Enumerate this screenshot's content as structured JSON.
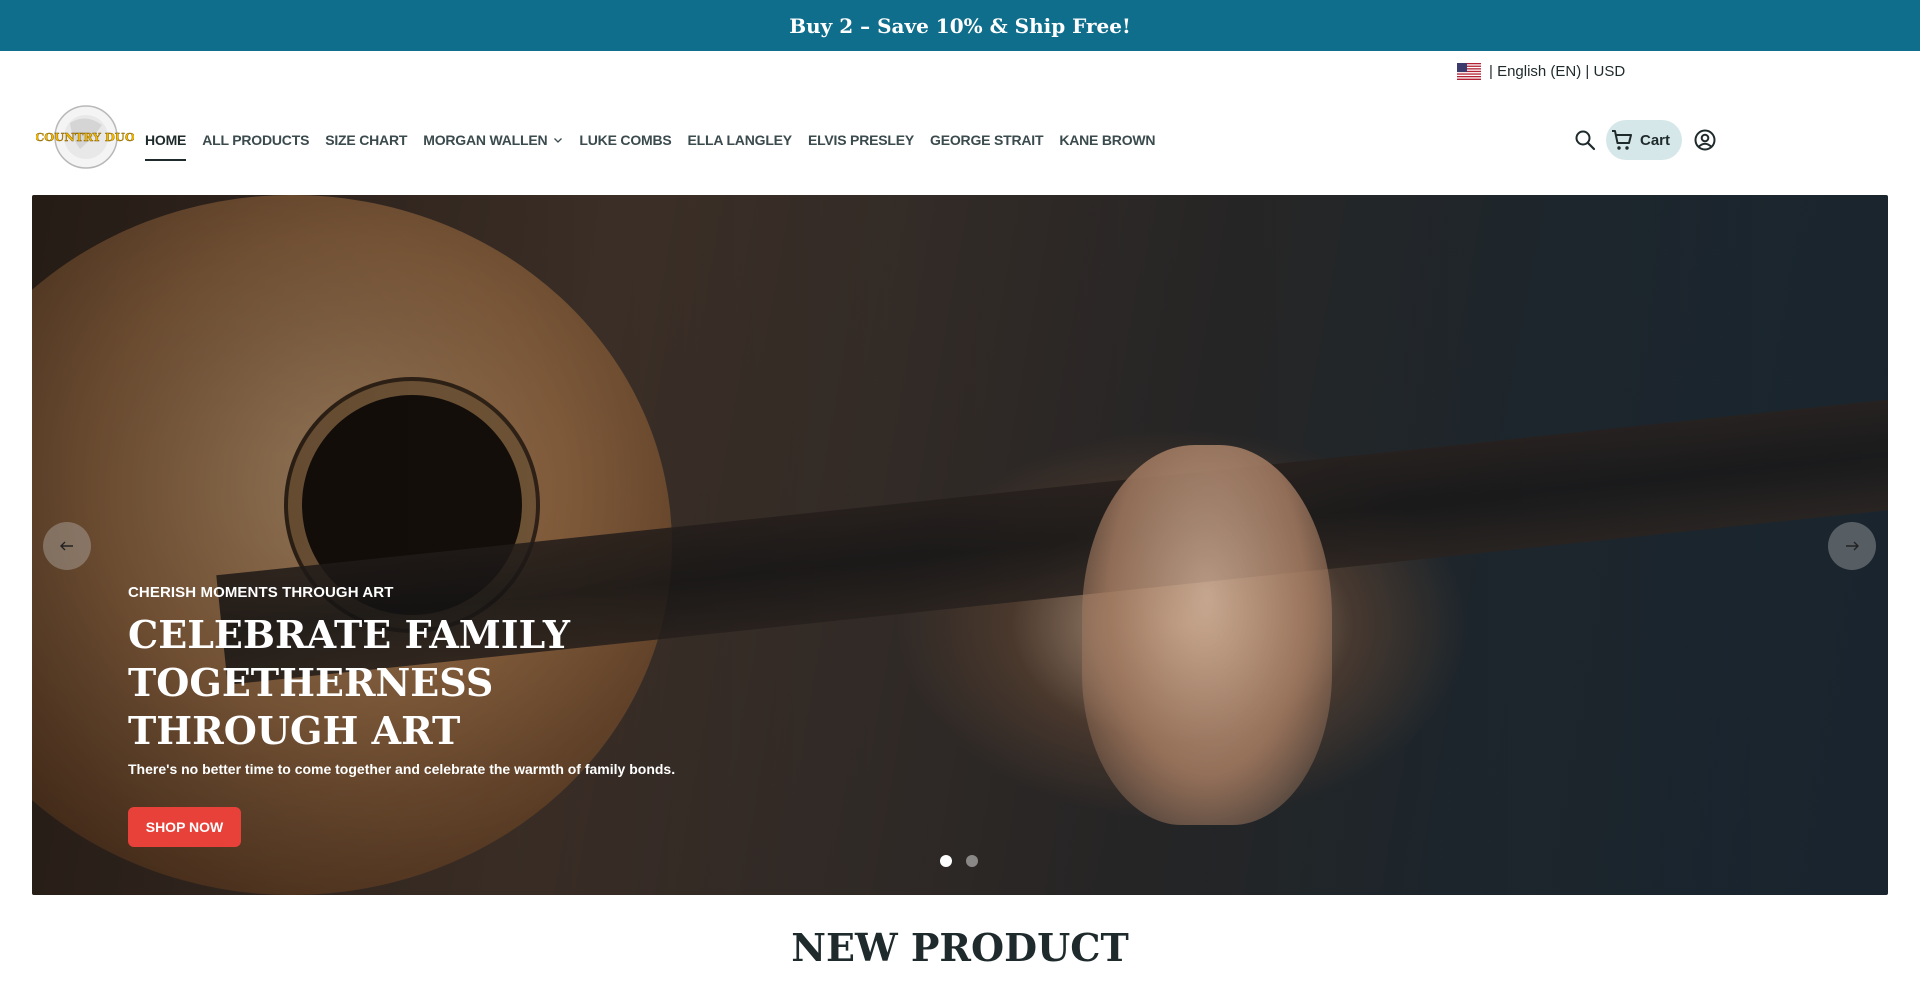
{
  "announcement": {
    "text": "Buy 2 – Save 10% & Ship Free!"
  },
  "locale": {
    "text": "| English (EN) | USD",
    "flag_icon": "us-flag-icon"
  },
  "logo": {
    "text": "COUNTRY DUO",
    "color": "#f5b800"
  },
  "nav": {
    "items": [
      {
        "label": "HOME",
        "active": true
      },
      {
        "label": "ALL PRODUCTS"
      },
      {
        "label": "SIZE CHART"
      },
      {
        "label": "MORGAN WALLEN",
        "has_dropdown": true
      },
      {
        "label": "LUKE COMBS"
      },
      {
        "label": "ELLA LANGLEY"
      },
      {
        "label": "ELVIS PRESLEY"
      },
      {
        "label": "GEORGE STRAIT"
      },
      {
        "label": "KANE BROWN"
      }
    ]
  },
  "header": {
    "search_icon": "search-icon",
    "cart_label": "Cart",
    "cart_icon": "cart-icon",
    "account_icon": "account-icon"
  },
  "hero": {
    "eyebrow": "CHERISH MOMENTS THROUGH ART",
    "title_line1": "CELEBRATE FAMILY TOGETHERNESS",
    "title_line2": "THROUGH ART",
    "subtitle": "There's no better time to come together and celebrate the warmth of family bonds.",
    "cta_label": "SHOP NOW",
    "cta_color": "#e8413a",
    "slides_total": 2,
    "active_slide": 1
  },
  "section": {
    "title": "NEW PRODUCT"
  },
  "colors": {
    "announcement_bg": "#0e6e8c",
    "cart_bg": "#d6e7e9"
  }
}
